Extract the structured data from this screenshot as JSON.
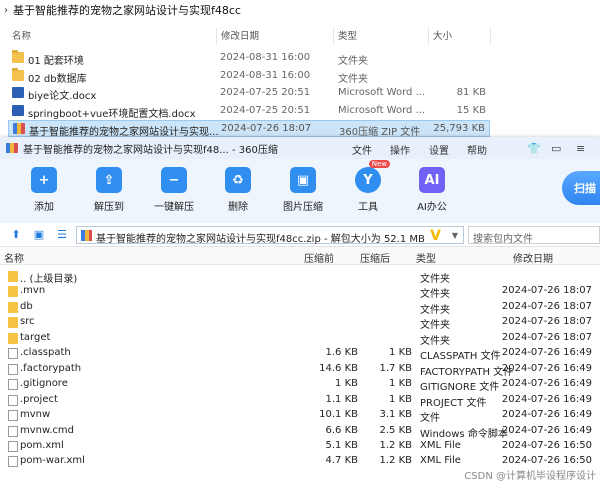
{
  "explorer": {
    "title": "基于智能推荐的宠物之家网站设计与实现f48cc",
    "columns": {
      "name": "名称",
      "date": "修改日期",
      "type": "类型",
      "size": "大小"
    },
    "rows": [
      {
        "name": "01 配套环境",
        "date": "2024-08-31 16:00",
        "type": "文件夹",
        "size": "",
        "icon": "folder-icon"
      },
      {
        "name": "02 db数据库",
        "date": "2024-08-31 16:00",
        "type": "文件夹",
        "size": "",
        "icon": "folder-icon"
      },
      {
        "name": "biye论文.docx",
        "date": "2024-07-25 20:51",
        "type": "Microsoft Word ...",
        "size": "81 KB",
        "icon": "word-doc-icon"
      },
      {
        "name": "springboot+vue环境配置文档.docx",
        "date": "2024-07-25 20:51",
        "type": "Microsoft Word ...",
        "size": "15 KB",
        "icon": "word-doc-icon"
      },
      {
        "name": "基于智能推荐的宠物之家网站设计与实现...",
        "date": "2024-07-26 18:07",
        "type": "360压缩 ZIP 文件",
        "size": "25,793 KB",
        "icon": "zip-archive-icon",
        "selected": true
      }
    ]
  },
  "zip_window": {
    "title": "基于智能推荐的宠物之家网站设计与实现f48... - 360压缩",
    "menu": [
      "文件",
      "操作",
      "设置",
      "帮助"
    ],
    "toolbar": [
      {
        "label": "添加",
        "icon": "add-icon",
        "color": "#2f8ef0"
      },
      {
        "label": "解压到",
        "icon": "extract-to-icon",
        "color": "#2f8ef0"
      },
      {
        "label": "一键解压",
        "icon": "one-click-extract-icon",
        "color": "#2f8ef0"
      },
      {
        "label": "删除",
        "icon": "recycle-bin-icon",
        "color": "#2f8ef0"
      },
      {
        "label": "图片压缩",
        "icon": "image-compress-icon",
        "color": "#2f8ef0"
      },
      {
        "label": "工具",
        "icon": "tools-icon",
        "color": "#2f8ef0",
        "badge": "New"
      },
      {
        "label": "AI办公",
        "icon": "ai-office-icon",
        "color": "#2f8ef0"
      }
    ],
    "scan_label": "扫描",
    "address": "基于智能推荐的宠物之家网站设计与实现f48cc.zip - 解包大小为 52.1 MB",
    "search_placeholder": "搜索包内文件",
    "columns": {
      "name": "名称",
      "orig": "压缩前",
      "comp": "压缩后",
      "type": "类型",
      "date": "修改日期"
    },
    "rows": [
      {
        "name": ".. (上级目录)",
        "orig": "",
        "comp": "",
        "type": "文件夹",
        "date": "",
        "kind": "folder"
      },
      {
        "name": ".mvn",
        "orig": "",
        "comp": "",
        "type": "文件夹",
        "date": "2024-07-26 18:07",
        "kind": "folder"
      },
      {
        "name": "db",
        "orig": "",
        "comp": "",
        "type": "文件夹",
        "date": "2024-07-26 18:07",
        "kind": "folder"
      },
      {
        "name": "src",
        "orig": "",
        "comp": "",
        "type": "文件夹",
        "date": "2024-07-26 18:07",
        "kind": "folder"
      },
      {
        "name": "target",
        "orig": "",
        "comp": "",
        "type": "文件夹",
        "date": "2024-07-26 18:07",
        "kind": "folder"
      },
      {
        "name": ".classpath",
        "orig": "1.6 KB",
        "comp": "1 KB",
        "type": "CLASSPATH 文件",
        "date": "2024-07-26 16:49",
        "kind": "file"
      },
      {
        "name": ".factorypath",
        "orig": "14.6 KB",
        "comp": "1.7 KB",
        "type": "FACTORYPATH 文件",
        "date": "2024-07-26 16:49",
        "kind": "file"
      },
      {
        "name": ".gitignore",
        "orig": "1 KB",
        "comp": "1 KB",
        "type": "GITIGNORE 文件",
        "date": "2024-07-26 16:49",
        "kind": "file"
      },
      {
        "name": ".project",
        "orig": "1.1 KB",
        "comp": "1 KB",
        "type": "PROJECT 文件",
        "date": "2024-07-26 16:49",
        "kind": "file"
      },
      {
        "name": "mvnw",
        "orig": "10.1 KB",
        "comp": "3.1 KB",
        "type": "文件",
        "date": "2024-07-26 16:49",
        "kind": "file"
      },
      {
        "name": "mvnw.cmd",
        "orig": "6.6 KB",
        "comp": "2.5 KB",
        "type": "Windows 命令脚本",
        "date": "2024-07-26 16:49",
        "kind": "file"
      },
      {
        "name": "pom.xml",
        "orig": "5.1 KB",
        "comp": "1.2 KB",
        "type": "XML File",
        "date": "2024-07-26 16:50",
        "kind": "file"
      },
      {
        "name": "pom-war.xml",
        "orig": "4.7 KB",
        "comp": "1.2 KB",
        "type": "XML File",
        "date": "2024-07-26 16:50",
        "kind": "file"
      }
    ]
  },
  "watermark": "CSDN @计算机毕设程序设计"
}
